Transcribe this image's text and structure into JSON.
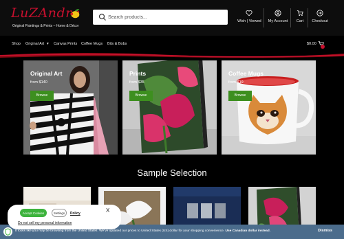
{
  "header": {
    "logo_text": "LuZAndre",
    "tagline": "Original Paintings & Prints – Home & Décor",
    "search_placeholder": "Search products...",
    "links": [
      {
        "label": "Wish | Viewed",
        "icon": "heart-icon"
      },
      {
        "label": "My Account",
        "icon": "user-icon"
      },
      {
        "label": "Cart",
        "icon": "cart-icon"
      },
      {
        "label": "Checkout",
        "icon": "arrow-right-circle-icon"
      }
    ]
  },
  "nav": {
    "items": [
      "Shop",
      "Original Art",
      "Canvas Prints",
      "Coffee Mugs",
      "Bits & Bobs"
    ],
    "cart_total": "$0.00"
  },
  "categories": [
    {
      "title": "Original Art",
      "price": "from $140",
      "button": "Browse"
    },
    {
      "title": "Prints",
      "price": "from $35",
      "button": "Browse"
    },
    {
      "title": "Coffee Mugs",
      "price": "from $19",
      "button": "Browse"
    }
  ],
  "section": {
    "title": "Sample Selection"
  },
  "notice": {
    "text": "It looks like you may be browsing from the United States. We’ve updated our prices to United States (US) dollar for your shopping convenience.",
    "link": "Use Canadian dollar instead.",
    "dismiss": "Dismiss"
  },
  "cookie": {
    "accept": "Accept Cookies",
    "settings": "Settings",
    "policy": "Policy",
    "close": "X",
    "do_not_sell": "Do not sell my personal information"
  },
  "colors": {
    "brand": "#c8102e",
    "button_green": "#3d8f1f",
    "notice_bg": "#4b6c8c",
    "accept_green": "#3db33d"
  }
}
